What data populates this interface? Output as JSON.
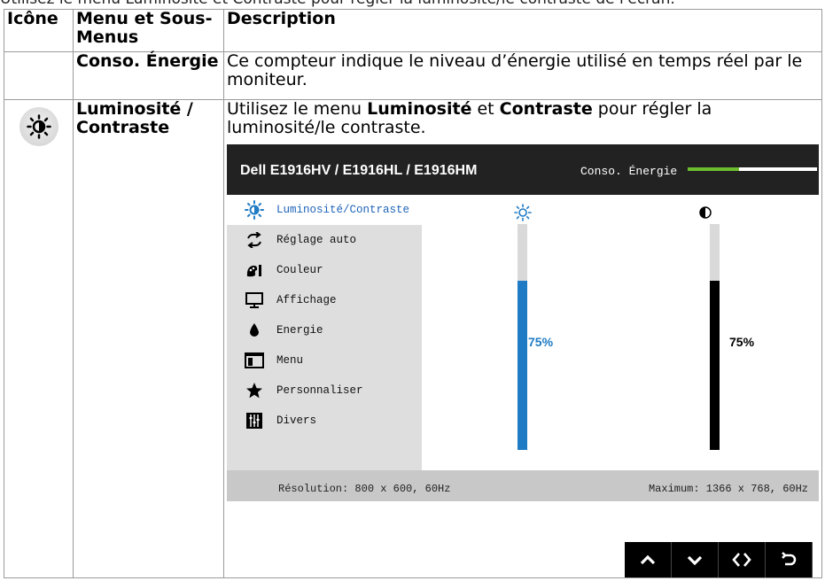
{
  "page": {
    "top_clipped_text": "Utilisez le menu Luminosité et Contraste pour régler la luminosité/le contraste de l'écran."
  },
  "table": {
    "headers": [
      "Icône",
      "Menu et Sous-Menus",
      "Description"
    ],
    "rows": [
      {
        "menu": "Conso. Énergie",
        "description": "Ce compteur indique le niveau d’énergie utilisé en temps réel par le moniteur."
      },
      {
        "menu": "Luminosité / Contraste",
        "description_part1": "Utilisez le menu ",
        "description_bold1": "Luminosité",
        "description_part2": " et ",
        "description_bold2": "Contraste",
        "description_part3": " pour régler la luminosité/le contraste."
      }
    ]
  },
  "osd": {
    "model": "Dell E1916HV / E1916HL / E1916HM",
    "energy_label": "Conso. Énergie",
    "energy_level": 0.4,
    "menu_items": [
      {
        "label": "Luminosité/Contraste",
        "icon": "brightness-icon",
        "active": true
      },
      {
        "label": "Réglage auto",
        "icon": "auto-adjust-icon",
        "active": false
      },
      {
        "label": "Couleur",
        "icon": "color-icon",
        "active": false
      },
      {
        "label": "Affichage",
        "icon": "display-icon",
        "active": false
      },
      {
        "label": "Energie",
        "icon": "energy-icon",
        "active": false
      },
      {
        "label": "Menu",
        "icon": "menu-icon",
        "active": false
      },
      {
        "label": "Personnaliser",
        "icon": "star-icon",
        "active": false
      },
      {
        "label": "Divers",
        "icon": "sliders-icon",
        "active": false
      }
    ],
    "brightness": {
      "value": 75,
      "label": "75%",
      "color": "#1f7bc4"
    },
    "contrast": {
      "value": 75,
      "label": "75%",
      "color": "#000000"
    },
    "resolution": "Résolution: 800 x 600, 60Hz",
    "maximum": "Maximum: 1366 x 768, 60Hz"
  },
  "nav_buttons": [
    "up-icon",
    "down-icon",
    "left-right-icon",
    "back-icon"
  ],
  "colors": {
    "accent": "#1f7bc4",
    "energy": "#6dbe2f",
    "osd_header": "#222222"
  }
}
